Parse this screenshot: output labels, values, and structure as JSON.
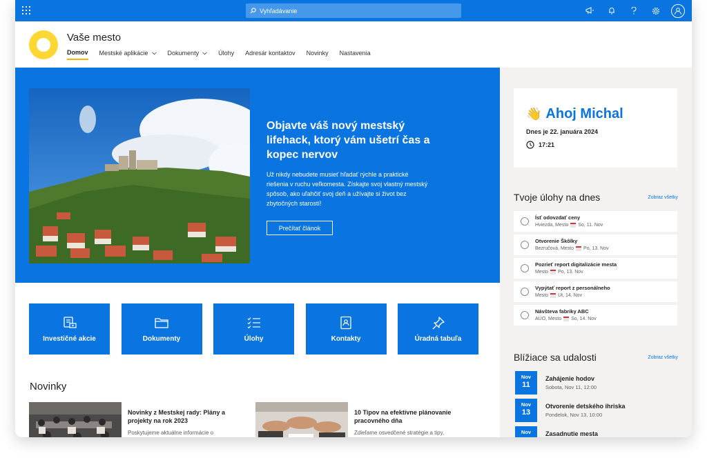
{
  "topbar": {
    "search_placeholder": "Vyhľadávanie",
    "icons": [
      "waffle-icon",
      "search-icon",
      "megaphone-icon",
      "bell-icon",
      "help-icon",
      "gear-icon",
      "avatar-icon"
    ]
  },
  "site": {
    "title": "Vaše mesto",
    "nav": [
      {
        "label": "Domov",
        "active": true
      },
      {
        "label": "Mestské aplikácie",
        "dropdown": true
      },
      {
        "label": "Dokumenty",
        "dropdown": true
      },
      {
        "label": "Úlohy"
      },
      {
        "label": "Adresár kontaktov"
      },
      {
        "label": "Novinky"
      },
      {
        "label": "Nastavenia"
      }
    ]
  },
  "hero": {
    "title": "Objavte váš nový mestský lifehack, ktorý vám ušetrí čas a kopec nervov",
    "text": "Už nikdy nebudete musieť hľadať rýchle a praktické riešenia v ruchu veľkomesta. Získajte svoj vlastný mestský spôsob, ako uľahčiť svoj deň a užívajte si život bez zbytočných starostí!",
    "button": "Prečítať článok"
  },
  "quick_links": [
    {
      "label": "Investičné akcie",
      "icon": "investment-icon"
    },
    {
      "label": "Dokumenty",
      "icon": "folder-icon"
    },
    {
      "label": "Úlohy",
      "icon": "tasklist-icon"
    },
    {
      "label": "Kontakty",
      "icon": "contact-icon"
    },
    {
      "label": "Úradná tabuľa",
      "icon": "pin-icon"
    }
  ],
  "news": {
    "title": "Novinky",
    "items": [
      {
        "title": "Novinky z Mestskej rady: Plány a projekty na rok 2023",
        "text": "Poskytujeme aktuálne informácie o plánoch a projektoch, ktoré sa"
      },
      {
        "title": "10 Tipov na efektívne plánovanie pracovného dňa",
        "text": "Zdieľame osvedčené stratégie a tipy, ktoré vám pomôžu efektívne"
      }
    ]
  },
  "greeting": {
    "title": "Ahoj Michal",
    "date": "Dnes je 22. januára 2024",
    "time": "17:21"
  },
  "tasks": {
    "title": "Tvoje úlohy na dnes",
    "link": "Zobraz všetky",
    "items": [
      {
        "name": "Ísť odovzdať ceny",
        "where": "Hviezda, Mesto",
        "when": "So, 11. Nov"
      },
      {
        "name": "Otvorenie Škôlky",
        "where": "Bezručová, Mesto",
        "when": "Po, 13. Nov"
      },
      {
        "name": "Pozrieť report digitalizácie mesta",
        "where": "Mesto",
        "when": "Po, 13. Nov"
      },
      {
        "name": "Vypýtať report z personálneho",
        "where": "Mesto",
        "when": "Ut, 14. Nov"
      },
      {
        "name": "Návšteva fabriky ABC",
        "where": "AUO, Mesto",
        "when": "So, 14. Nov"
      }
    ]
  },
  "events": {
    "title": "Blížiace sa udalosti",
    "link": "Zobraz všetky",
    "items": [
      {
        "month": "Nov",
        "day": "11",
        "name": "Zahájenie hodov",
        "meta": "Sobota, Nov 11, 12:00"
      },
      {
        "month": "Nov",
        "day": "13",
        "name": "Otvorenie detského ihriska",
        "meta": "Pondelok, Nov 13, 10:00"
      },
      {
        "month": "Nov",
        "day": "",
        "name": "Zasadnutie mesta",
        "meta": ""
      }
    ]
  },
  "colors": {
    "accent": "#0a74e0",
    "logo": "#fdd835",
    "panel": "#f3f2f1"
  }
}
